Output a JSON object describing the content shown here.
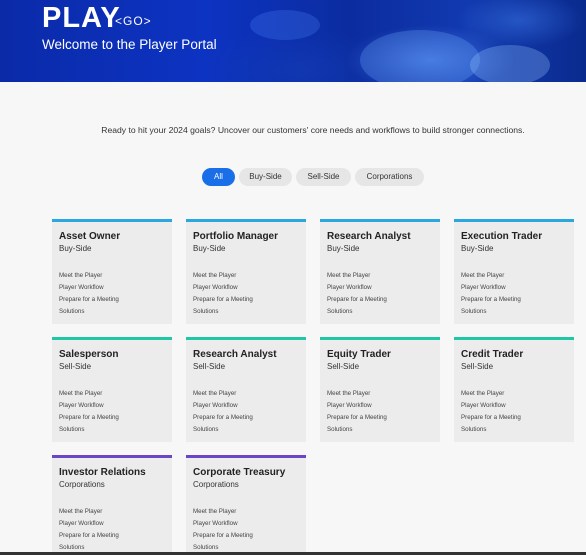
{
  "hero": {
    "logo": "PLAY",
    "logo_sub": "<GO>",
    "title": "Welcome to the Player Portal"
  },
  "intro": "Ready to hit your 2024 goals? Uncover our customers' core needs and workflows to build stronger connections.",
  "filters": [
    {
      "label": "All",
      "active": true
    },
    {
      "label": "Buy-Side",
      "active": false
    },
    {
      "label": "Sell-Side",
      "active": false
    },
    {
      "label": "Corporations",
      "active": false
    }
  ],
  "card_links": [
    "Meet the Player",
    "Player Workflow",
    "Prepare for a Meeting",
    "Solutions"
  ],
  "cards": [
    {
      "title": "Asset Owner",
      "category": "Buy-Side"
    },
    {
      "title": "Portfolio Manager",
      "category": "Buy-Side"
    },
    {
      "title": "Research Analyst",
      "category": "Buy-Side"
    },
    {
      "title": "Execution Trader",
      "category": "Buy-Side"
    },
    {
      "title": "Salesperson",
      "category": "Sell-Side"
    },
    {
      "title": "Research Analyst",
      "category": "Sell-Side"
    },
    {
      "title": "Equity Trader",
      "category": "Sell-Side"
    },
    {
      "title": "Credit Trader",
      "category": "Sell-Side"
    },
    {
      "title": "Investor Relations",
      "category": "Corporations"
    },
    {
      "title": "Corporate Treasury",
      "category": "Corporations"
    }
  ],
  "colors": {
    "buy_side_accent": "#2aa7e0",
    "sell_side_accent": "#1fc7a5",
    "corporations_accent": "#6a46c7",
    "active_filter": "#1a6fe8"
  }
}
